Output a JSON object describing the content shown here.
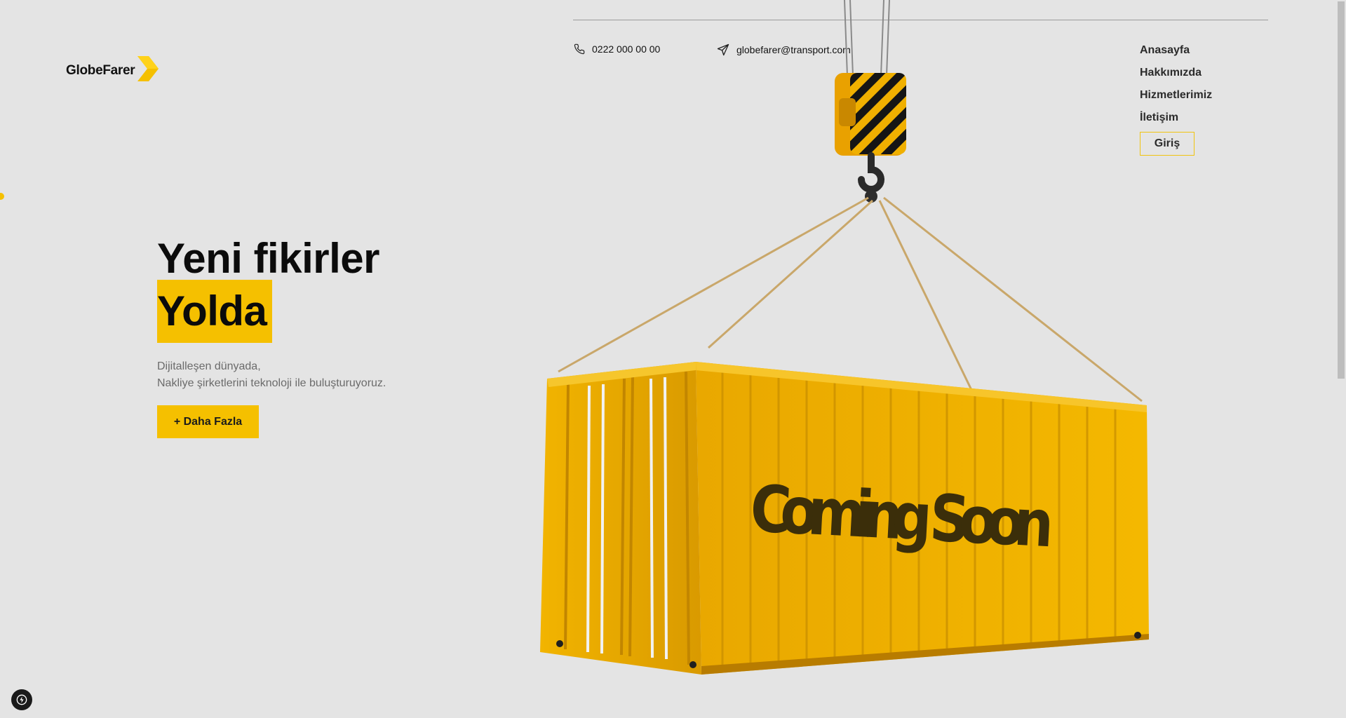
{
  "brand": {
    "name": "GlobeFarer",
    "logo_icon": "chevron-arrow-icon",
    "accent": "#f5c000"
  },
  "contact": {
    "phone": "0222 000 00 00",
    "phone_icon": "phone-icon",
    "email": "globefarer@transport.com",
    "email_icon": "send-icon"
  },
  "nav": {
    "items": [
      {
        "label": "Anasayfa"
      },
      {
        "label": "Hakkımızda"
      },
      {
        "label": "Hizmetlerimiz"
      },
      {
        "label": "İletişim"
      }
    ],
    "login_label": "Giriş"
  },
  "hero": {
    "title_line1": "Yeni fikirler",
    "title_line2": "Yolda",
    "subtitle_line1": "Dijitalleşen dünyada,",
    "subtitle_line2": "Nakliye şirketlerini teknoloji ile buluşturuyoruz.",
    "cta_label": "+ Daha Fazla"
  },
  "illustration": {
    "container_text": "Coming Soon",
    "container_color": "#f0b400"
  },
  "overlay": {
    "dev_badge_icon": "bolt-icon"
  }
}
